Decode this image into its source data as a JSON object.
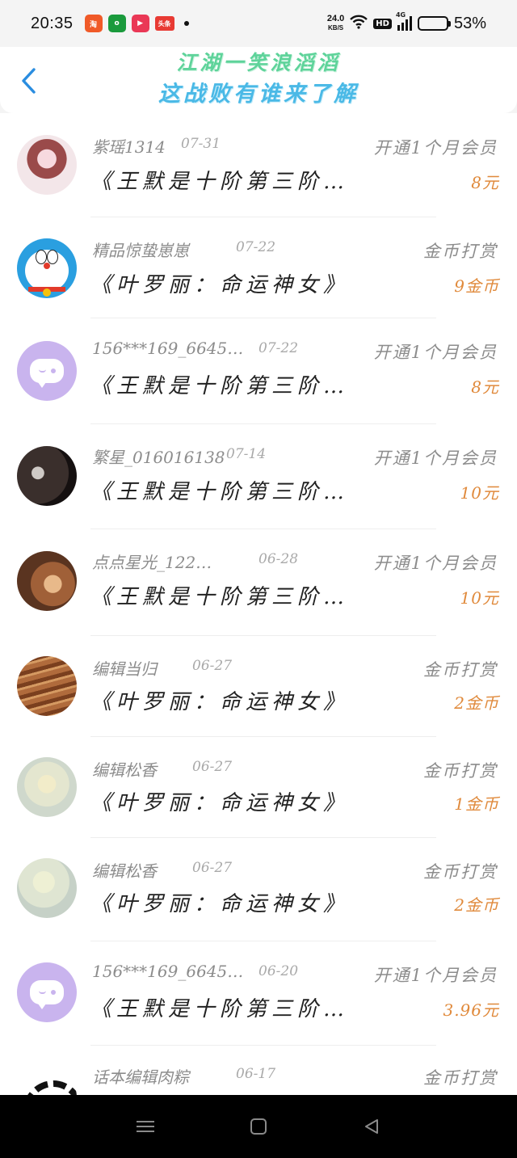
{
  "status_bar": {
    "time": "20:35",
    "app_icons": [
      "淘宝",
      "oppo",
      "视频",
      "头条"
    ],
    "net_speed": "24.0",
    "net_unit": "KB/S",
    "hd": "HD",
    "signal": "4G",
    "battery_pct": "53%"
  },
  "header": {
    "back_icon": "‹",
    "title_line1": "江湖一笑浪滔滔",
    "title_line2": "这战败有谁来了解"
  },
  "list": [
    {
      "username": "紫瑶1314",
      "date": "07-31",
      "book": "《王默是十阶第三阶…",
      "type": "开通1个月会员",
      "amount": "8元",
      "avatar": "anime"
    },
    {
      "username": "精品惊蛰崽崽",
      "date": "07-22",
      "book": "《叶罗丽：命运神女》",
      "type": "金币打赏",
      "amount": "9金币",
      "avatar": "doraemon"
    },
    {
      "username": "156***169_6645…",
      "date": "07-22",
      "book": "《王默是十阶第三阶…",
      "type": "开通1个月会员",
      "amount": "8元",
      "avatar": "chat"
    },
    {
      "username": "繁星_016016138",
      "date": "07-14",
      "book": "《王默是十阶第三阶…",
      "type": "开通1个月会员",
      "amount": "10元",
      "avatar": "dark"
    },
    {
      "username": "点点星光_122…",
      "date": "06-28",
      "book": "《王默是十阶第三阶…",
      "type": "开通1个月会员",
      "amount": "10元",
      "avatar": "warm"
    },
    {
      "username": "编辑当归",
      "date": "06-27",
      "book": "《叶罗丽：命运神女》",
      "type": "金币打赏",
      "amount": "2金币",
      "avatar": "wood"
    },
    {
      "username": "编辑松香",
      "date": "06-27",
      "book": "《叶罗丽：命运神女》",
      "type": "金币打赏",
      "amount": "1金币",
      "avatar": "mist"
    },
    {
      "username": "编辑松香",
      "date": "06-27",
      "book": "《叶罗丽：命运神女》",
      "type": "金币打赏",
      "amount": "2金币",
      "avatar": "mist2"
    },
    {
      "username": "156***169_6645…",
      "date": "06-20",
      "book": "《王默是十阶第三阶…",
      "type": "开通1个月会员",
      "amount": "3.96元",
      "avatar": "chat"
    },
    {
      "username": "话本编辑肉粽",
      "date": "06-17",
      "book": "",
      "type": "金币打赏",
      "amount": "",
      "avatar": "bw"
    }
  ],
  "colors": {
    "accent_back": "#2a8de0",
    "amount": "#e08a3c",
    "title_line1": "#5ed39a",
    "title_line2": "#4ab9e6"
  }
}
